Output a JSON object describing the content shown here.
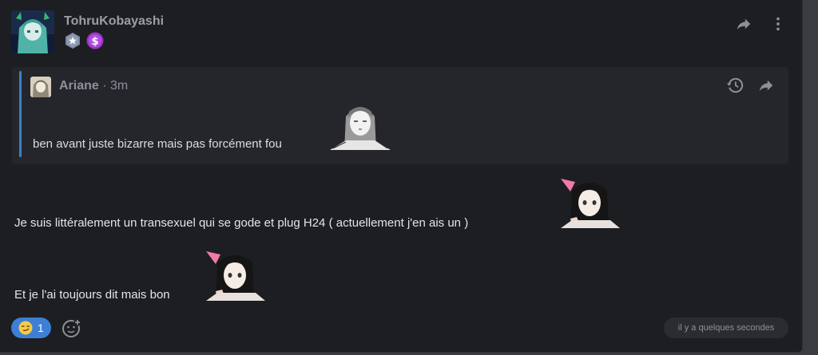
{
  "post": {
    "username": "TohruKobayashi",
    "badges": [
      "star-shield-badge",
      "dollar-badge"
    ]
  },
  "header_actions": [
    "share-icon",
    "more-vertical-icon"
  ],
  "quote": {
    "author": "Ariane",
    "separator": " · ",
    "time": "3m",
    "text": "ben avant juste bizarre mais pas forcément fou",
    "actions": [
      "history-icon",
      "share-icon"
    ]
  },
  "messages": [
    "Je suis littéralement un transexuel qui se gode et plug H24 ( actuellement j'en ais un )",
    "Et je l'ai toujours dit mais bon"
  ],
  "reaction": {
    "emoji": "😏",
    "count": "1"
  },
  "timestamp": "il y a quelques secondes",
  "colors": {
    "background": "#1d1e22",
    "quote_bg": "#25262b",
    "accent": "#3d7fd4",
    "text": "#e4e5e8"
  }
}
